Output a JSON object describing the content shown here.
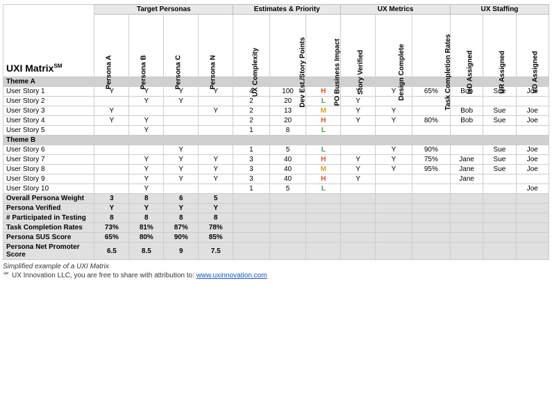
{
  "title": "UXI Matrix",
  "title_sm": "SM",
  "headers": {
    "target_personas": "Target Personas",
    "estimates": "Estimates & Priority",
    "ux_metrics": "UX Metrics",
    "ux_staffing": "UX Staffing",
    "personas": [
      "Persona A",
      "Persona B",
      "Persona C",
      "Persona N"
    ],
    "ux_complexity": "UX Complexity",
    "dev_est": "Dev Est./Story Points",
    "po_business": "PO Business Impact",
    "story_verified": "Story Verified",
    "design_complete": "Design Complete",
    "task_completion": "Task Completion Rates",
    "ixd_assigned": "IxD Assigned",
    "ur_assigned": "UR Assigned",
    "vd_assigned": "VD Assigned"
  },
  "themes": [
    {
      "name": "Theme A",
      "stories": [
        {
          "name": "User Story 1",
          "pA": "Y",
          "pB": "Y",
          "pC": "Y",
          "pN": "Y",
          "ux": "4",
          "dev": "100",
          "po": "H",
          "sv": "Y",
          "dc": "Y",
          "tc": "65%",
          "ixd": "Bob",
          "ur": "Sue",
          "vd": "Joe"
        },
        {
          "name": "User Story 2",
          "pA": "",
          "pB": "Y",
          "pC": "Y",
          "pN": "",
          "ux": "2",
          "dev": "20",
          "po": "L",
          "sv": "Y",
          "dc": "",
          "tc": "",
          "ixd": "",
          "ur": "",
          "vd": ""
        },
        {
          "name": "User Story 3",
          "pA": "Y",
          "pB": "",
          "pC": "",
          "pN": "Y",
          "ux": "2",
          "dev": "13",
          "po": "M",
          "sv": "Y",
          "dc": "Y",
          "tc": "",
          "ixd": "Bob",
          "ur": "Sue",
          "vd": "Joe"
        },
        {
          "name": "User Story 4",
          "pA": "Y",
          "pB": "Y",
          "pC": "",
          "pN": "",
          "ux": "2",
          "dev": "20",
          "po": "H",
          "sv": "Y",
          "dc": "Y",
          "tc": "80%",
          "ixd": "Bob",
          "ur": "Sue",
          "vd": "Joe"
        },
        {
          "name": "User Story 5",
          "pA": "",
          "pB": "Y",
          "pC": "",
          "pN": "",
          "ux": "1",
          "dev": "8",
          "po": "L",
          "sv": "",
          "dc": "",
          "tc": "",
          "ixd": "",
          "ur": "",
          "vd": ""
        }
      ]
    },
    {
      "name": "Theme B",
      "stories": [
        {
          "name": "User Story 6",
          "pA": "",
          "pB": "",
          "pC": "Y",
          "pN": "",
          "ux": "1",
          "dev": "5",
          "po": "L",
          "sv": "",
          "dc": "Y",
          "tc": "90%",
          "ixd": "",
          "ur": "Sue",
          "vd": "Joe"
        },
        {
          "name": "User Story 7",
          "pA": "",
          "pB": "Y",
          "pC": "Y",
          "pN": "Y",
          "ux": "3",
          "dev": "40",
          "po": "H",
          "sv": "Y",
          "dc": "Y",
          "tc": "75%",
          "ixd": "Jane",
          "ur": "Sue",
          "vd": "Joe"
        },
        {
          "name": "User Story 8",
          "pA": "",
          "pB": "Y",
          "pC": "Y",
          "pN": "Y",
          "ux": "3",
          "dev": "40",
          "po": "M",
          "sv": "Y",
          "dc": "Y",
          "tc": "95%",
          "ixd": "Jane",
          "ur": "Sue",
          "vd": "Joe"
        },
        {
          "name": "User Story 9",
          "pA": "",
          "pB": "Y",
          "pC": "Y",
          "pN": "Y",
          "ux": "3",
          "dev": "40",
          "po": "H",
          "sv": "Y",
          "dc": "",
          "tc": "",
          "ixd": "Jane",
          "ur": "",
          "vd": ""
        },
        {
          "name": "User Story 10",
          "pA": "",
          "pB": "Y",
          "pC": "",
          "pN": "",
          "ux": "1",
          "dev": "5",
          "po": "L",
          "sv": "",
          "dc": "",
          "tc": "",
          "ixd": "",
          "ur": "",
          "vd": "Joe"
        }
      ]
    }
  ],
  "summary": [
    {
      "label": "Overall Persona Weight",
      "pA": "3",
      "pB": "8",
      "pC": "6",
      "pN": "5",
      "rest": ""
    },
    {
      "label": "Persona Verified",
      "pA": "Y",
      "pB": "Y",
      "pC": "Y",
      "pN": "Y",
      "rest": ""
    },
    {
      "label": "# Participated in Testing",
      "pA": "8",
      "pB": "8",
      "pC": "8",
      "pN": "8",
      "rest": ""
    },
    {
      "label": "Task Completion Rates",
      "pA": "73%",
      "pB": "81%",
      "pC": "87%",
      "pN": "78%",
      "rest": ""
    },
    {
      "label": "Persona SUS Score",
      "pA": "65%",
      "pB": "80%",
      "pC": "90%",
      "pN": "85%",
      "rest": ""
    },
    {
      "label": "Persona Net Promoter Score",
      "pA": "6.5",
      "pB": "8.5",
      "pC": "9",
      "pN": "7.5",
      "rest": ""
    }
  ],
  "footer": {
    "note": "Simplified example of a UXI Matrix",
    "copy": "℠ UX Innovation LLC, you are free to share with attribution to:",
    "link_text": "www.uxinnovation.com",
    "link_url": "http://www.uxinnovation.com"
  }
}
